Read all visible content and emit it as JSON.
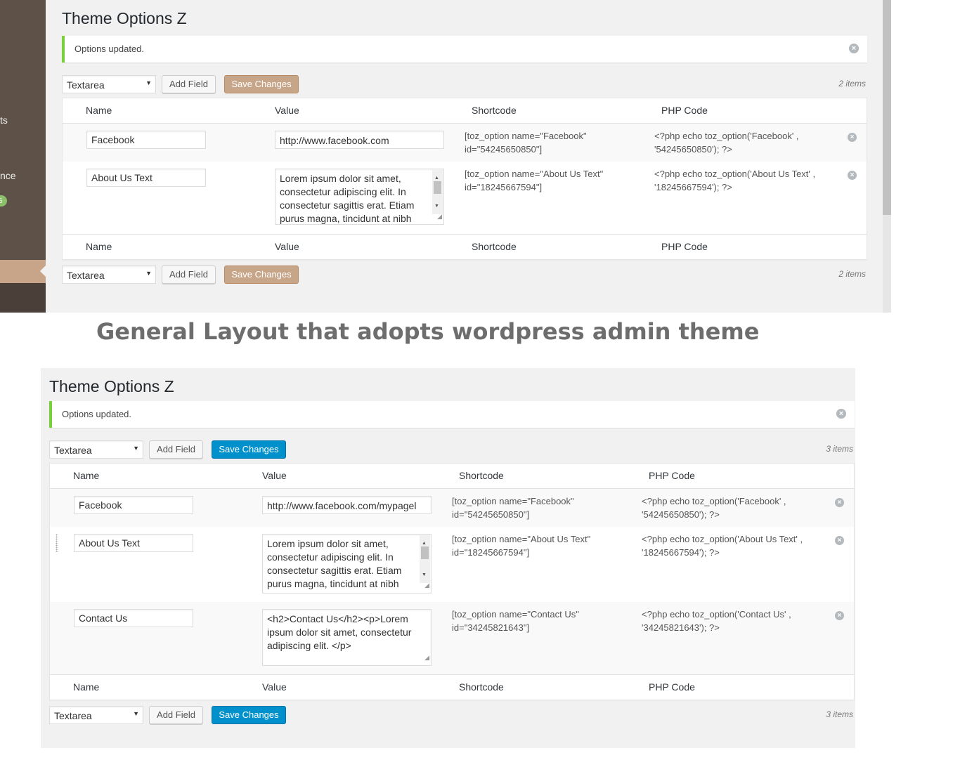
{
  "caption": "General Layout that adopts wordpress admin theme",
  "sidebar": {
    "fragments": [
      "ts",
      "nce"
    ],
    "badge": "5"
  },
  "top": {
    "title": "Theme Options Z",
    "notice": "Options updated.",
    "toolbar": {
      "select_value": "Textarea",
      "add_label": "Add Field",
      "save_label": "Save Changes",
      "count": "2 items"
    },
    "columns": [
      "Name",
      "Value",
      "Shortcode",
      "PHP Code"
    ],
    "rows": [
      {
        "name": "Facebook",
        "value": "http://www.facebook.com",
        "shortcode": "[toz_option name=\"Facebook\" id=\"54245650850\"]",
        "php": "<?php echo toz_option('Facebook' , '54245650850'); ?>"
      },
      {
        "name": "About Us Text",
        "value": "Lorem ipsum dolor sit amet, consectetur adipiscing elit. In consectetur sagittis erat. Etiam purus magna, tincidunt at nibh",
        "shortcode": "[toz_option name=\"About Us Text\" id=\"18245667594\"]",
        "php": "<?php echo toz_option('About Us Text' , '18245667594'); ?>"
      }
    ],
    "accent": "#c7a589"
  },
  "bottom": {
    "title": "Theme Options Z",
    "notice": "Options updated.",
    "toolbar": {
      "select_value": "Textarea",
      "add_label": "Add Field",
      "save_label": "Save Changes",
      "count": "3 items"
    },
    "columns": [
      "Name",
      "Value",
      "Shortcode",
      "PHP Code"
    ],
    "rows": [
      {
        "name": "Facebook",
        "value": "http://www.facebook.com/mypagel",
        "shortcode": "[toz_option name=\"Facebook\" id=\"54245650850\"]",
        "php": "<?php echo toz_option('Facebook' , '54245650850'); ?>"
      },
      {
        "name": "About Us Text",
        "value": "Lorem ipsum dolor sit amet, consectetur adipiscing elit. In consectetur sagittis erat. Etiam purus magna, tincidunt at nibh",
        "shortcode": "[toz_option name=\"About Us Text\" id=\"18245667594\"]",
        "php": "<?php echo toz_option('About Us Text' , '18245667594'); ?>"
      },
      {
        "name": "Contact Us",
        "value": "<h2>Contact Us</h2><p>Lorem ipsum dolor sit amet, consectetur adipiscing elit. </p>",
        "shortcode": "[toz_option name=\"Contact Us\" id=\"34245821643\"]",
        "php": "<?php echo toz_option('Contact Us' , '34245821643'); ?>"
      }
    ],
    "accent": "#0091cd"
  }
}
